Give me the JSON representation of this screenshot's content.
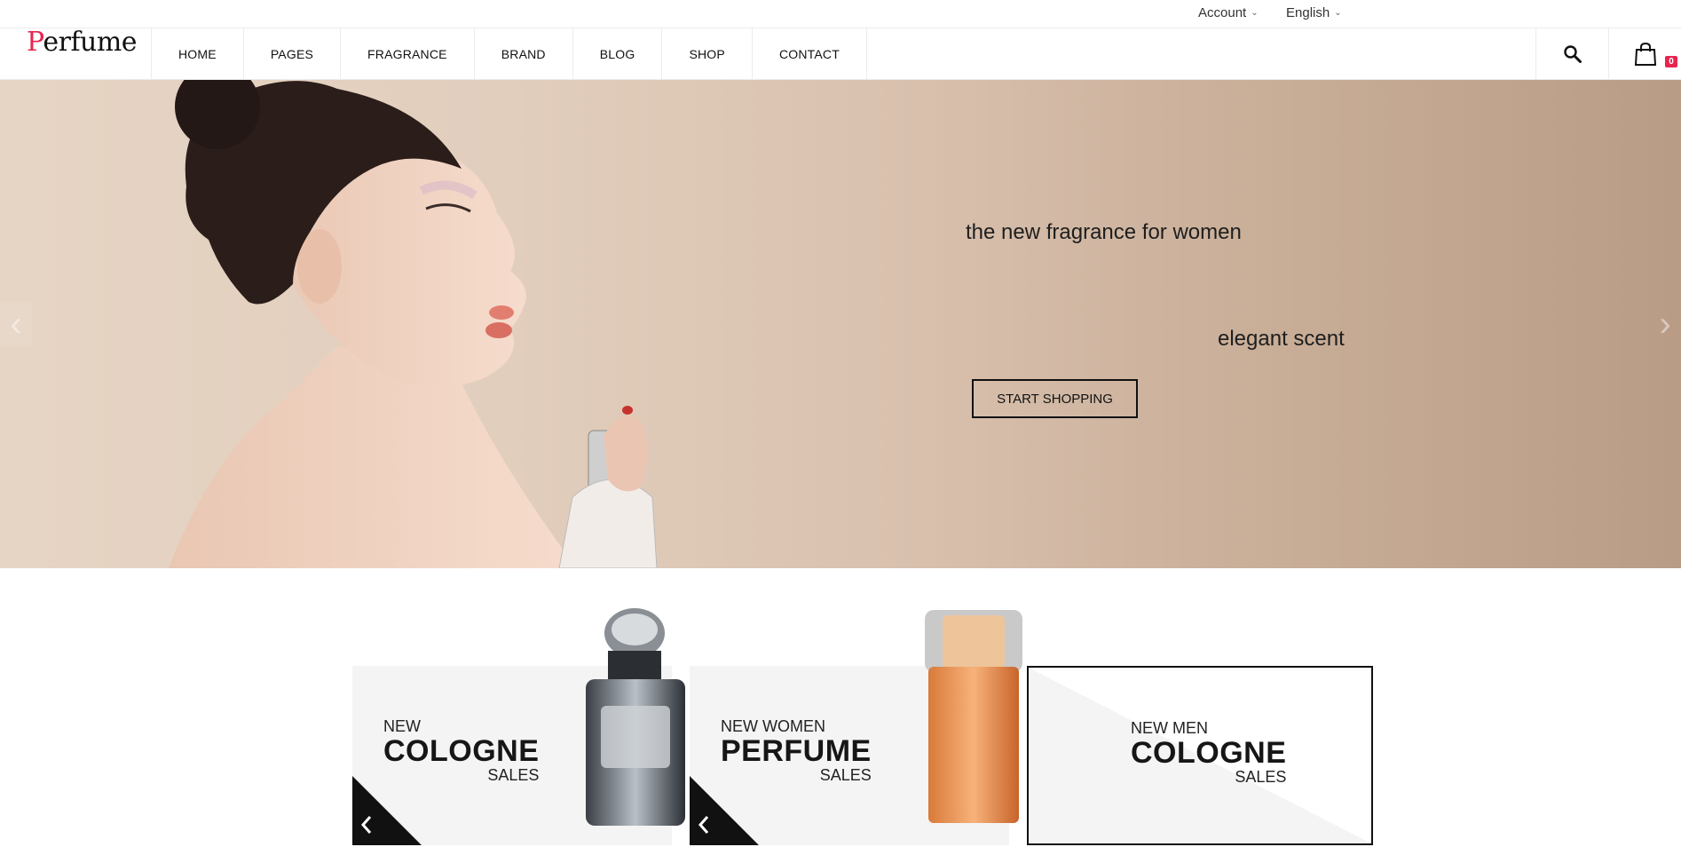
{
  "topbar": {
    "account_label": "Account",
    "language_label": "English"
  },
  "header": {
    "logo_first": "P",
    "logo_rest": "erfume",
    "nav": [
      "HOME",
      "PAGES",
      "FRAGRANCE",
      "BRAND",
      "BLOG",
      "SHOP",
      "CONTACT"
    ],
    "cart_count": "0"
  },
  "hero": {
    "line1": "the new fragrance for women",
    "line2": "elegant scent",
    "cta_label": "START SHOPPING"
  },
  "banners": [
    {
      "small": "NEW",
      "big": "COLOGNE",
      "sales": "SALES"
    },
    {
      "small": "NEW WOMEN",
      "big": "PERFUME",
      "sales": "SALES"
    },
    {
      "small": "NEW MEN",
      "big": "COLOGNE",
      "sales": "SALES"
    }
  ],
  "colors": {
    "accent": "#e8254f",
    "hero_bg": "#d8c0ad",
    "banner_bg": "#f4f4f4"
  }
}
